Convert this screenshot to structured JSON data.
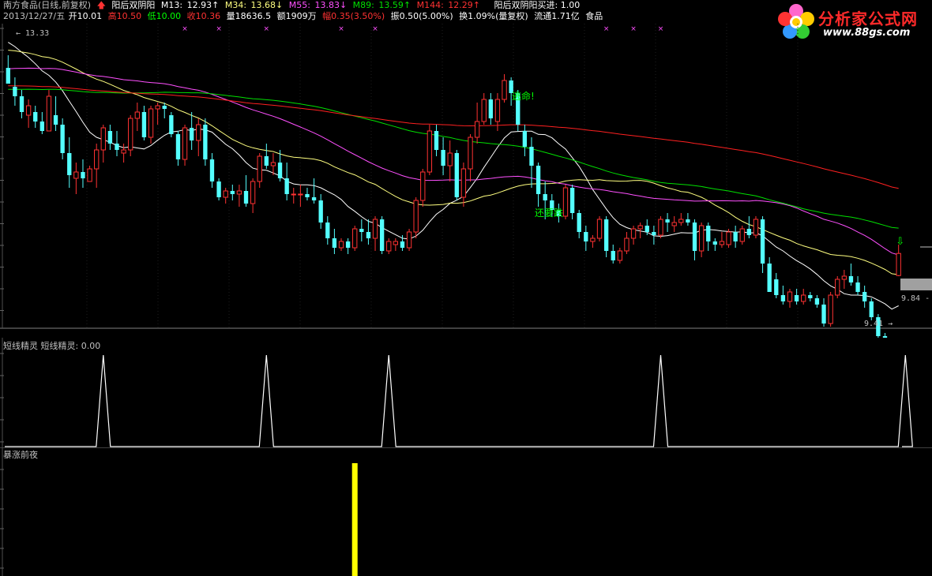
{
  "header": {
    "stock": "南方食品(日线,前复权)",
    "indicator_name": "阳后双阴阳",
    "m13_label": "M13:",
    "m13_value": "12.93↑",
    "m34_label": "M34:",
    "m34_value": "13.68↓",
    "m55_label": "M55:",
    "m55_value": "13.83↓",
    "m89_label": "M89:",
    "m89_value": "13.59↑",
    "m144_label": "M144:",
    "m144_value": "12.29↑",
    "buy_signal": "阳后双阴阳买进: 1.00",
    "date": "2013/12/27/五",
    "open": "开10.01",
    "high": "高10.50",
    "low": "低10.00",
    "close": "收10.36",
    "volume": "量18636.5",
    "amount": "额1909万",
    "change": "幅0.35(3.50%)",
    "amplitude": "振0.50(5.00%)",
    "turnover": "换1.09%(量复权)",
    "float_cap": "流通1.71亿",
    "sector": "食品"
  },
  "logo": {
    "cn": "分析家公式网",
    "url": "www.88gs.com"
  },
  "colors": {
    "up": "#ff3232",
    "down": "#54ffff",
    "ma13": "#ffffff",
    "ma34": "#ffff80",
    "ma55": "#ff50ff",
    "ma89": "#00e000",
    "ma144": "#ff2020",
    "text_up": "#ff3232",
    "text_down": "#00ff00",
    "ma55_text": "#ff50ff",
    "yellow_bar": "#ffff00",
    "annotation": "#00ff00"
  },
  "panels": {
    "ind1_title": "短线精灵  短线精灵: 0.00",
    "ind2_title": "暴涨前夜"
  },
  "chart_data": [
    {
      "type": "candlestick",
      "title": "南方食品(日线,前复权)",
      "ylim": [
        9.2,
        14.0
      ],
      "price_labels": {
        "high_marker": "13.33",
        "low_marker": "9.41",
        "last": "9.84"
      },
      "annotations": [
        "逃命!",
        "还要跌"
      ],
      "candles": [
        [
          13.3,
          13.5,
          13.05,
          13.05
        ],
        [
          13.0,
          13.15,
          12.7,
          12.85
        ],
        [
          12.85,
          12.95,
          12.5,
          12.6
        ],
        [
          12.55,
          12.8,
          12.35,
          12.7
        ],
        [
          12.6,
          12.7,
          12.35,
          12.45
        ],
        [
          12.45,
          12.6,
          12.25,
          12.3
        ],
        [
          12.3,
          12.95,
          12.3,
          12.85
        ],
        [
          12.55,
          12.85,
          12.3,
          12.4
        ],
        [
          12.4,
          12.5,
          11.85,
          11.95
        ],
        [
          11.95,
          12.2,
          11.4,
          11.6
        ],
        [
          11.55,
          11.8,
          11.3,
          11.65
        ],
        [
          11.65,
          11.85,
          11.4,
          11.55
        ],
        [
          11.5,
          11.75,
          11.5,
          11.7
        ],
        [
          11.7,
          12.1,
          11.4,
          12.0
        ],
        [
          12.0,
          12.4,
          11.8,
          12.35
        ],
        [
          12.3,
          12.4,
          12.0,
          12.1
        ],
        [
          12.1,
          12.3,
          11.9,
          12.0
        ],
        [
          11.95,
          12.1,
          11.8,
          12.0
        ],
        [
          12.0,
          12.55,
          11.9,
          12.5
        ],
        [
          12.5,
          12.75,
          12.3,
          12.6
        ],
        [
          12.6,
          12.7,
          12.15,
          12.2
        ],
        [
          12.2,
          12.7,
          12.1,
          12.65
        ],
        [
          12.65,
          12.75,
          12.4,
          12.7
        ],
        [
          12.7,
          12.75,
          12.5,
          12.65
        ],
        [
          12.55,
          12.6,
          12.2,
          12.25
        ],
        [
          12.25,
          12.3,
          11.75,
          11.85
        ],
        [
          11.85,
          12.4,
          11.75,
          12.35
        ],
        [
          12.35,
          12.6,
          12.0,
          12.15
        ],
        [
          12.15,
          12.5,
          11.9,
          12.4
        ],
        [
          12.4,
          12.5,
          11.75,
          11.85
        ],
        [
          11.85,
          11.95,
          11.4,
          11.5
        ],
        [
          11.5,
          11.55,
          11.2,
          11.25
        ],
        [
          11.25,
          11.4,
          11.15,
          11.35
        ],
        [
          11.35,
          11.45,
          11.2,
          11.3
        ],
        [
          11.3,
          11.45,
          11.1,
          11.35
        ],
        [
          11.35,
          11.6,
          11.1,
          11.15
        ],
        [
          11.15,
          11.55,
          11.0,
          11.5
        ],
        [
          11.5,
          11.95,
          11.4,
          11.9
        ],
        [
          11.9,
          12.1,
          11.7,
          11.75
        ],
        [
          11.75,
          11.95,
          11.6,
          11.8
        ],
        [
          11.8,
          12.0,
          11.5,
          11.55
        ],
        [
          11.55,
          11.8,
          11.2,
          11.3
        ],
        [
          11.3,
          11.4,
          11.15,
          11.3
        ],
        [
          11.3,
          11.45,
          11.1,
          11.3
        ],
        [
          11.3,
          11.4,
          11.2,
          11.25
        ],
        [
          11.25,
          11.55,
          11.15,
          11.2
        ],
        [
          11.2,
          11.3,
          10.75,
          10.85
        ],
        [
          10.85,
          10.95,
          10.5,
          10.6
        ],
        [
          10.6,
          10.75,
          10.35,
          10.45
        ],
        [
          10.45,
          10.6,
          10.4,
          10.55
        ],
        [
          10.55,
          10.6,
          10.35,
          10.45
        ],
        [
          10.45,
          10.8,
          10.4,
          10.75
        ],
        [
          10.75,
          10.9,
          10.55,
          10.7
        ],
        [
          10.7,
          10.9,
          10.5,
          10.6
        ],
        [
          10.6,
          10.95,
          10.4,
          10.9
        ],
        [
          10.9,
          10.95,
          10.35,
          10.4
        ],
        [
          10.4,
          10.6,
          10.35,
          10.55
        ],
        [
          10.5,
          10.6,
          10.4,
          10.55
        ],
        [
          10.55,
          10.65,
          10.4,
          10.45
        ],
        [
          10.45,
          10.75,
          10.4,
          10.7
        ],
        [
          10.7,
          11.25,
          10.6,
          11.2
        ],
        [
          11.2,
          11.7,
          11.1,
          11.65
        ],
        [
          11.65,
          12.4,
          11.6,
          12.3
        ],
        [
          12.3,
          12.4,
          11.9,
          12.0
        ],
        [
          12.0,
          12.2,
          11.6,
          11.75
        ],
        [
          11.75,
          12.15,
          11.5,
          11.95
        ],
        [
          11.95,
          12.0,
          11.2,
          11.25
        ],
        [
          11.25,
          11.8,
          11.1,
          11.7
        ],
        [
          11.7,
          12.25,
          11.5,
          12.2
        ],
        [
          12.2,
          12.75,
          12.1,
          12.45
        ],
        [
          12.45,
          12.9,
          12.4,
          12.8
        ],
        [
          12.8,
          12.9,
          12.4,
          12.5
        ],
        [
          12.45,
          12.9,
          12.3,
          12.8
        ],
        [
          12.8,
          13.2,
          12.75,
          13.1
        ],
        [
          13.1,
          13.15,
          12.7,
          12.9
        ],
        [
          12.9,
          12.95,
          12.3,
          12.4
        ],
        [
          12.3,
          12.4,
          11.9,
          12.05
        ],
        [
          12.05,
          12.2,
          11.4,
          11.75
        ],
        [
          11.75,
          11.8,
          11.1,
          11.3
        ],
        [
          11.3,
          11.5,
          10.9,
          11.2
        ],
        [
          11.2,
          11.3,
          10.95,
          11.05
        ],
        [
          11.05,
          11.15,
          10.85,
          10.95
        ],
        [
          10.95,
          11.45,
          10.9,
          11.4
        ],
        [
          11.4,
          11.45,
          10.9,
          11.0
        ],
        [
          11.0,
          11.05,
          10.6,
          10.7
        ],
        [
          10.7,
          10.8,
          10.4,
          10.55
        ],
        [
          10.55,
          10.65,
          10.45,
          10.6
        ],
        [
          10.6,
          10.95,
          10.55,
          10.9
        ],
        [
          10.9,
          10.95,
          10.3,
          10.4
        ],
        [
          10.4,
          10.5,
          10.2,
          10.25
        ],
        [
          10.25,
          10.45,
          10.2,
          10.4
        ],
        [
          10.4,
          10.7,
          10.35,
          10.6
        ],
        [
          10.6,
          10.8,
          10.5,
          10.75
        ],
        [
          10.75,
          10.85,
          10.6,
          10.8
        ],
        [
          10.8,
          10.9,
          10.65,
          10.7
        ],
        [
          10.7,
          10.8,
          10.5,
          10.65
        ],
        [
          10.65,
          10.95,
          10.6,
          10.9
        ],
        [
          10.9,
          11.0,
          10.7,
          10.85
        ],
        [
          10.8,
          10.95,
          10.7,
          10.85
        ],
        [
          10.85,
          11.0,
          10.8,
          10.9
        ],
        [
          10.9,
          11.0,
          10.8,
          10.85
        ],
        [
          10.85,
          10.9,
          10.25,
          10.4
        ],
        [
          10.4,
          10.85,
          10.3,
          10.8
        ],
        [
          10.8,
          10.85,
          10.4,
          10.55
        ],
        [
          10.55,
          10.6,
          10.4,
          10.5
        ],
        [
          10.5,
          10.7,
          10.45,
          10.55
        ],
        [
          10.5,
          10.75,
          10.45,
          10.7
        ],
        [
          10.7,
          10.8,
          10.45,
          10.55
        ],
        [
          10.55,
          10.8,
          10.5,
          10.75
        ],
        [
          10.75,
          10.95,
          10.6,
          10.65
        ],
        [
          10.65,
          10.95,
          10.6,
          10.9
        ],
        [
          10.9,
          10.95,
          10.05,
          10.2
        ],
        [
          10.2,
          10.3,
          9.9,
          9.75
        ],
        [
          9.95,
          10.05,
          9.65,
          9.7
        ],
        [
          9.7,
          9.85,
          9.55,
          9.6
        ],
        [
          9.6,
          9.8,
          9.5,
          9.75
        ],
        [
          9.7,
          9.8,
          9.55,
          9.6
        ],
        [
          9.6,
          9.8,
          9.55,
          9.7
        ],
        [
          9.7,
          9.75,
          9.6,
          9.65
        ],
        [
          9.65,
          9.7,
          9.5,
          9.55
        ],
        [
          9.55,
          9.65,
          9.2,
          9.25
        ],
        [
          9.25,
          9.75,
          9.2,
          9.7
        ],
        [
          9.7,
          10.0,
          9.65,
          9.95
        ],
        [
          9.95,
          10.1,
          9.8,
          10.0
        ],
        [
          10.0,
          10.2,
          9.85,
          9.9
        ],
        [
          9.9,
          10.0,
          9.7,
          9.75
        ],
        [
          9.75,
          9.85,
          9.5,
          9.6
        ],
        [
          9.6,
          9.65,
          9.3,
          9.35
        ],
        [
          9.35,
          9.4,
          9.0,
          9.05
        ],
        [
          9.05,
          9.1,
          8.75,
          8.85
        ],
        [
          8.85,
          9.0,
          8.55,
          8.6
        ],
        [
          10.01,
          10.5,
          10.0,
          10.36
        ]
      ]
    },
    {
      "type": "line",
      "title": "短线精灵",
      "ylim": [
        0,
        1
      ],
      "spikes_at": [
        14,
        38,
        56,
        96,
        132
      ]
    },
    {
      "type": "bar",
      "title": "暴涨前夜",
      "ylim": [
        0,
        1
      ],
      "bars_at": [
        51
      ]
    }
  ]
}
